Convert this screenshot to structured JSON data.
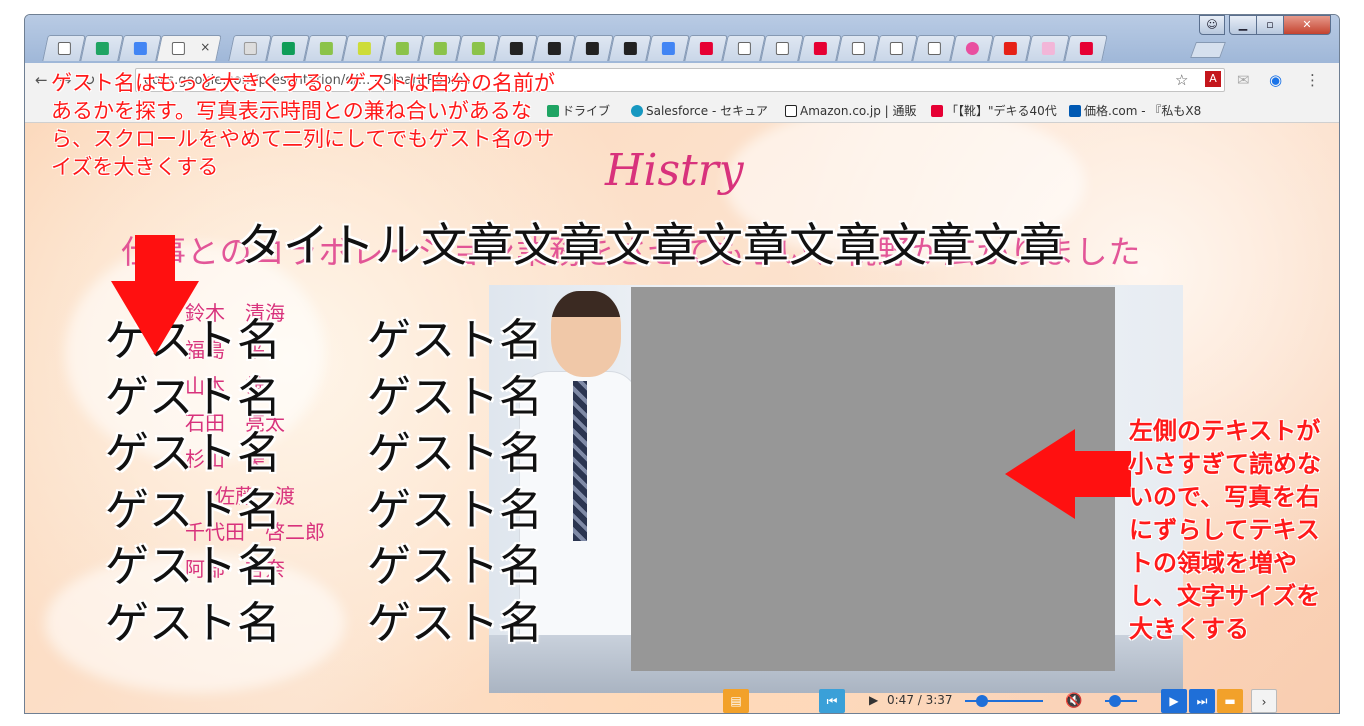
{
  "address_bar": {
    "url": "docs.google.com/presentation/d/... - Smart Rooms"
  },
  "bookmarks": [
    {
      "label": "ドライブ",
      "icon": "drive-icon",
      "color": "#1fa463"
    },
    {
      "label": "Salesforce - セキュア",
      "icon": "salesforce-icon",
      "color": "#1798c1"
    },
    {
      "label": "Amazon.co.jp | 通販",
      "icon": "amazon-icon",
      "color": "#222222"
    },
    {
      "label": "「【靴】\"デキる40代",
      "icon": "yahoo-icon",
      "color": "#e60033"
    },
    {
      "label": "価格.com - 『私もX8",
      "icon": "kakaku-icon",
      "color": "#0059b3"
    }
  ],
  "slide": {
    "logo_text": "Histry",
    "subtitle": "仕事とのコラボレーション業務をさせてもらい、視野が広がりました",
    "title": "タイトル文章文章文章文章文章文章文章",
    "small_names": [
      "鈴木　清海",
      "福島　平",
      "山本　雄",
      "石田　亮太",
      "杉山　美",
      "佐藤　渡",
      "千代田　啓二郎",
      "阿部　杏奈"
    ],
    "guest_names": [
      "ゲスト名",
      "ゲスト名",
      "ゲスト名",
      "ゲスト名",
      "ゲスト名",
      "ゲスト名",
      "ゲスト名",
      "ゲスト名",
      "ゲスト名",
      "ゲスト名",
      "ゲスト名",
      "ゲスト名"
    ]
  },
  "annotations": {
    "top_note": "ゲスト名はもっと大きくする。ゲストは自分の名前があるかを探す。写真表示時間との兼ね合いがあるなら、スクロールをやめて二列にしてでもゲスト名のサイズを大きくする",
    "right_note": "左側のテキストが小さすぎて読めないので、写真を右にずらしてテキストの領域を増やし、文字サイズを大きくする",
    "color": "#ff1a1a"
  },
  "player": {
    "time": "0:47 / 3:37",
    "progress_fraction": 0.22,
    "volume_fraction": 0.3
  },
  "colors": {
    "accent_pink": "#d8327c",
    "player_blue": "#1f6fd8",
    "orange_button": "#f2a12a"
  }
}
